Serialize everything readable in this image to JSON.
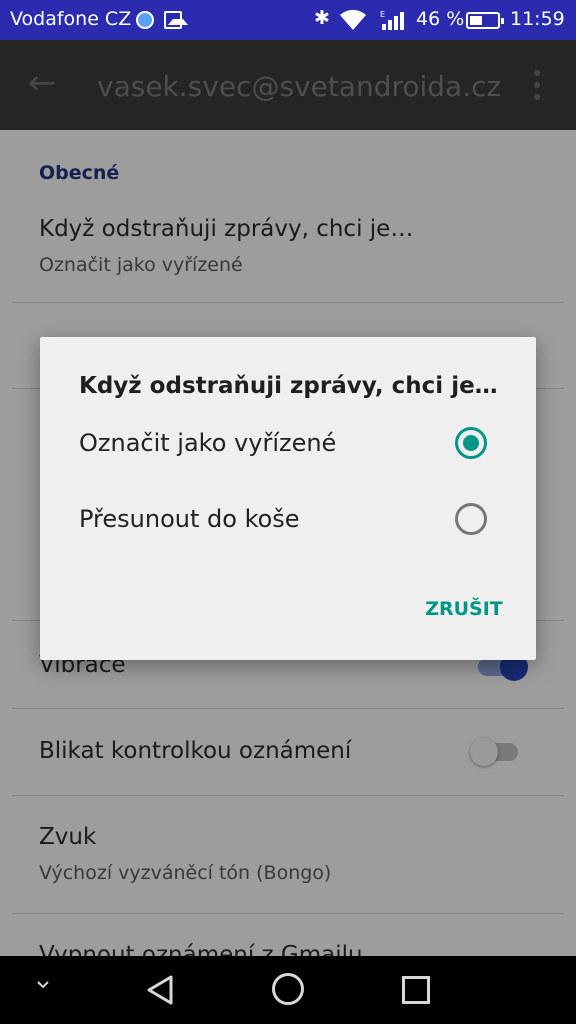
{
  "status_bar": {
    "carrier": "Vodafone CZ",
    "network_type": "E",
    "battery_percent": "46 %",
    "battery_level": 0.46,
    "time": "11:59",
    "icons": [
      "messenger-bubble-icon",
      "image-icon",
      "bluetooth-icon",
      "wifi-icon",
      "signal-icon",
      "battery-icon"
    ]
  },
  "toolbar": {
    "title": "vasek.svec@svetandroida.cz",
    "back_icon": "arrow-back-icon",
    "overflow_icon": "more-vert-icon"
  },
  "settings": {
    "section_header": "Obecné",
    "delete_pref": {
      "title": "Když odstraňuji zprávy, chci je…",
      "summary": "Označit jako vyřízené"
    },
    "vibrate_pref": {
      "title": "Vibrace",
      "enabled": true
    },
    "led_pref": {
      "title": "Blikat kontrolkou oznámení",
      "enabled": false
    },
    "sound_pref": {
      "title": "Zvuk",
      "summary": "Výchozí vyzváněcí tón (Bongo)"
    },
    "mute_pref": {
      "title": "Vypnout oznámení z Gmailu"
    }
  },
  "dialog": {
    "title": "Když odstraňuji zprávy, chci je…",
    "options": [
      {
        "label": "Označit jako vyřízené",
        "selected": true
      },
      {
        "label": "Přesunout do koše",
        "selected": false
      }
    ],
    "cancel_label": "ZRUŠIT"
  },
  "colors": {
    "status_bar": "#2b2bb0",
    "accent": "#009688",
    "toggle_on": "#2344b8"
  },
  "nav_bar": {
    "icons": [
      "chevron-down-icon",
      "back-triangle-icon",
      "home-circle-icon",
      "recents-square-icon"
    ]
  }
}
